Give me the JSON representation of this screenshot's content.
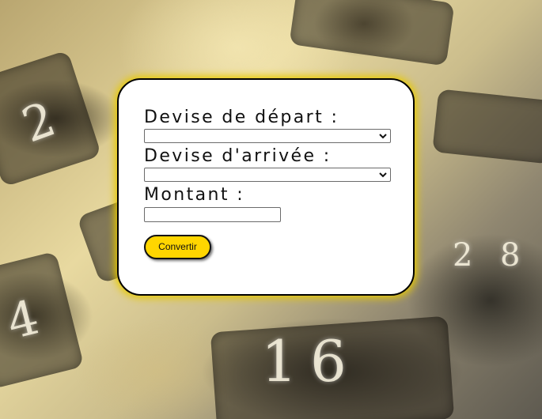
{
  "form": {
    "from_label": "Devise de départ :",
    "from_value": "",
    "to_label": "Devise d'arrivée :",
    "to_value": "",
    "amount_label": "Montant :",
    "amount_value": "",
    "submit_label": "Convertir"
  },
  "background": {
    "glyphs": [
      "1",
      "6",
      "2",
      "4",
      "2",
      "8"
    ]
  },
  "colors": {
    "card_background": "#ffffff",
    "card_border": "#000000",
    "card_glow": "#e7c900",
    "button_fill": "#ffd600"
  }
}
